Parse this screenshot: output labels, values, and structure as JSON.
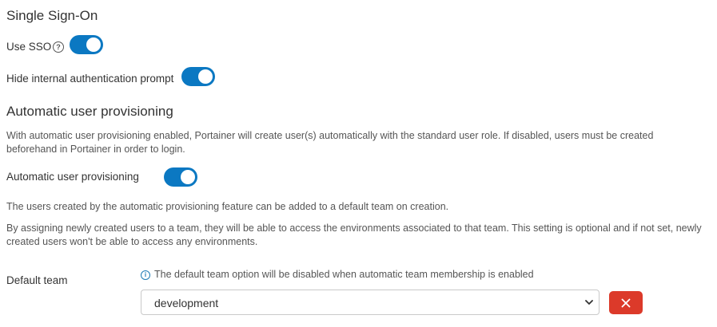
{
  "sso": {
    "title": "Single Sign-On",
    "use_sso_label": "Use SSO",
    "use_sso_enabled": true,
    "hide_prompt_label": "Hide internal authentication prompt",
    "hide_prompt_enabled": true
  },
  "provisioning": {
    "title": "Automatic user provisioning",
    "description": "With automatic user provisioning enabled, Portainer will create user(s) automatically with the standard user role. If disabled, users must be created beforehand in Portainer in order to login.",
    "toggle_label": "Automatic user provisioning",
    "toggle_enabled": true,
    "team_note": "The users created by the automatic provisioning feature can be added to a default team on creation.",
    "team_note_2": "By assigning newly created users to a team, they will be able to access the environments associated to that team. This setting is optional and if not set, newly created users won't be able to access any environments."
  },
  "default_team": {
    "label": "Default team",
    "info": "The default team option will be disabled when automatic team membership is enabled",
    "selected": "development"
  },
  "colors": {
    "toggle_on": "#0b78c2",
    "danger": "#dc3a2a",
    "info": "#1f7bb5"
  },
  "icons": {
    "help": "question-circle-icon",
    "info": "info-circle-icon",
    "chevron": "chevron-down-icon",
    "remove": "close-icon"
  }
}
